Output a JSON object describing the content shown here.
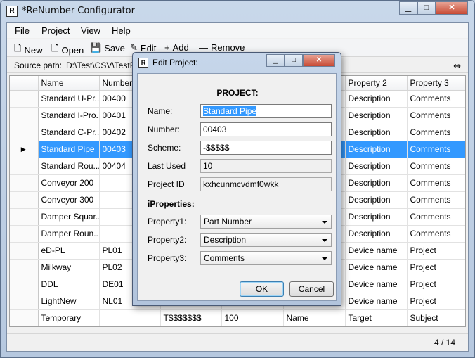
{
  "window": {
    "title": "*ReNumber Configurator",
    "icon_letter": "R"
  },
  "menu": {
    "file": "File",
    "project": "Project",
    "view": "View",
    "help": "Help"
  },
  "toolbar": {
    "new": "New",
    "open": "Open",
    "save": "Save",
    "edit": "Edit",
    "add": "Add",
    "remove": "Remove"
  },
  "pathbar": {
    "label": "Source path:",
    "value": "D:\\Test\\CSV\\TestF"
  },
  "grid": {
    "headers": [
      "Name",
      "Number",
      "",
      "",
      "",
      "Property 2",
      "Property 3"
    ],
    "rows": [
      [
        "Standard U-Pr...",
        "00400",
        "",
        "",
        "",
        "Description",
        "Comments"
      ],
      [
        "Standard I-Pro...",
        "00401",
        "",
        "",
        "",
        "Description",
        "Comments"
      ],
      [
        "Standard C-Pr...",
        "00402",
        "",
        "",
        "",
        "Description",
        "Comments"
      ],
      [
        "Standard Pipe",
        "00403",
        "",
        "",
        "",
        "Description",
        "Comments"
      ],
      [
        "Standard Rou...",
        "00404",
        "",
        "",
        "",
        "Description",
        "Comments"
      ],
      [
        "Conveyor 200",
        "",
        "",
        "",
        "",
        "Description",
        "Comments"
      ],
      [
        "Conveyor 300",
        "",
        "",
        "",
        "",
        "Description",
        "Comments"
      ],
      [
        "Damper Squar...",
        "",
        "",
        "",
        "",
        "Description",
        "Comments"
      ],
      [
        "Damper Roun...",
        "",
        "",
        "",
        "",
        "Description",
        "Comments"
      ],
      [
        "eD-PL",
        "PL01",
        "",
        "",
        "",
        "Device name",
        "Project"
      ],
      [
        "Milkway",
        "PL02",
        "",
        "",
        "",
        "Device name",
        "Project"
      ],
      [
        "DDL",
        "DE01",
        "",
        "",
        "",
        "Device name",
        "Project"
      ],
      [
        "LightNew",
        "NL01",
        "",
        "",
        "",
        "Device name",
        "Project"
      ],
      [
        "Temporary",
        "",
        "T$$$$$$$",
        "100",
        "Name",
        "Target",
        "Subject"
      ]
    ],
    "selected_row": 3
  },
  "status": {
    "count": "4 / 14"
  },
  "dialog": {
    "title": "Edit Project:",
    "heading": "PROJECT:",
    "name_label": "Name:",
    "name_value": "Standard Pipe",
    "number_label": "Number:",
    "number_value": "00403",
    "scheme_label": "Scheme:",
    "scheme_value": "-$$$$$",
    "lastused_label": "Last Used",
    "lastused_value": "10",
    "projectid_label": "Project ID",
    "projectid_value": "kxhcunmcvdmf0wkk",
    "iprops_title": "iProperties:",
    "prop1_label": "Property1:",
    "prop1_value": "Part Number",
    "prop2_label": "Property2:",
    "prop2_value": "Description",
    "prop3_label": "Property3:",
    "prop3_value": "Comments",
    "ok": "OK",
    "cancel": "Cancel"
  }
}
